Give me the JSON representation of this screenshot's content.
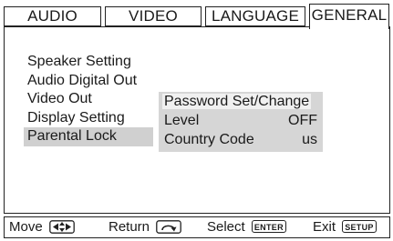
{
  "tabs": [
    {
      "label": "AUDIO"
    },
    {
      "label": "VIDEO"
    },
    {
      "label": "LANGUAGE"
    },
    {
      "label": "GENERAL"
    }
  ],
  "active_tab": "GENERAL",
  "menu": {
    "items": [
      {
        "label": "Speaker Setting"
      },
      {
        "label": "Audio Digital Out"
      },
      {
        "label": "Video Out"
      },
      {
        "label": "Display Setting"
      },
      {
        "label": "Parental Lock"
      }
    ],
    "selected": "Parental Lock"
  },
  "submenu": {
    "rows": [
      {
        "label": "Password Set/Change",
        "value": ""
      },
      {
        "label": "Level",
        "value": "OFF"
      },
      {
        "label": "Country Code",
        "value": "us"
      }
    ],
    "highlighted": "Password Set/Change"
  },
  "helpbar": {
    "move": {
      "label": "Move",
      "icon": "arrow-keys-icon"
    },
    "return": {
      "label": "Return",
      "icon": "return-key-icon"
    },
    "select": {
      "label": "Select",
      "key": "ENTER"
    },
    "exit": {
      "label": "Exit",
      "key": "SETUP"
    }
  },
  "colors": {
    "border": "#222222",
    "selected_bg": "#d0d0d0",
    "submenu_bg": "#d6d6d6",
    "highlight_bg": "#f0f0f0"
  }
}
